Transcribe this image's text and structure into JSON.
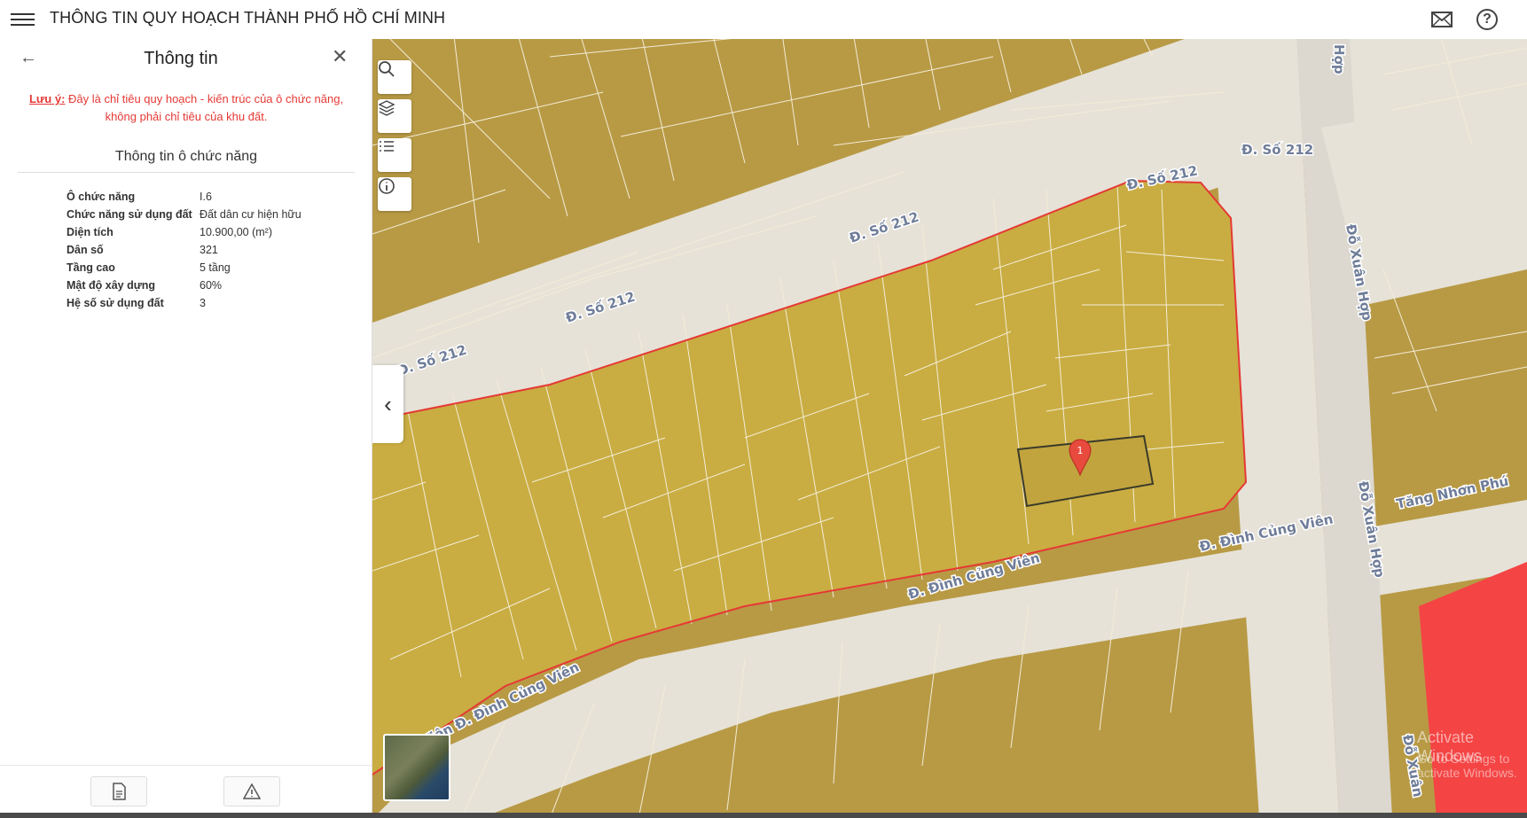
{
  "header": {
    "title": "THÔNG TIN QUY HOẠCH THÀNH PHỐ HỒ CHÍ MINH"
  },
  "panel": {
    "title": "Thông tin",
    "note_label": "Lưu ý:",
    "note_text": " Đây là chỉ tiêu quy hoạch - kiến trúc của ô chức năng, không phải chỉ tiêu của khu đất.",
    "section_title": "Thông tin ô chức năng",
    "rows": [
      {
        "label": "Ô chức năng",
        "value": "I.6"
      },
      {
        "label": "Chức năng sử dụng đất",
        "value": "Đất dân cư hiện hữu"
      },
      {
        "label": "Diện tích",
        "value": "10.900,00 (m²)"
      },
      {
        "label": "Dân số",
        "value": "321"
      },
      {
        "label": "Tầng cao",
        "value": "5 tầng"
      },
      {
        "label": "Mật độ xây dựng",
        "value": "60%"
      },
      {
        "label": "Hệ số sử dụng đất",
        "value": "3"
      }
    ]
  },
  "map": {
    "marker_label": "1",
    "roads": [
      "Đ. Số 212",
      "Đ. Số 212",
      "Đ. Số 212",
      "Đ. Số 212",
      "Đ. Số 212",
      "Đỗ Xuân Hợp",
      "Đỗ Xuân Hợp",
      "Đỗ Xuân",
      "Hợp",
      "Tăng Nhơn Phú",
      "Đ. Đình Củng Viên",
      "Đ. Đình Củng Viên",
      "Viên Đ. Đình Củng Viên"
    ],
    "watermark_title": "Activate Windows",
    "watermark_sub": "Go to Settings to activate Windows.",
    "colors": {
      "land": "#b89a45",
      "block": "#c9ad42",
      "road": "#e6e2d8",
      "boundary": "#e53935",
      "red_zone": "#f44444"
    }
  },
  "icons": [
    "menu-icon",
    "mail-icon",
    "help-icon",
    "back-arrow-icon",
    "close-icon",
    "search-icon",
    "layers-icon",
    "list-icon",
    "info-icon",
    "chevron-left-icon",
    "document-icon",
    "warning-icon",
    "map-marker-icon"
  ]
}
